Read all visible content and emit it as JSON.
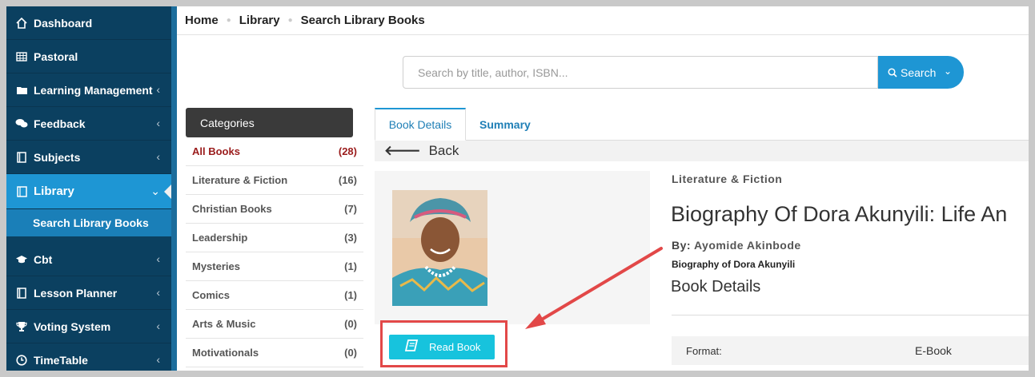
{
  "sidebar": {
    "items": [
      {
        "label": "Dashboard",
        "icon": "home-icon"
      },
      {
        "label": "Pastoral",
        "icon": "table-icon"
      },
      {
        "label": "Learning Management",
        "icon": "folder-icon"
      },
      {
        "label": "Feedback",
        "icon": "chat-icon"
      },
      {
        "label": "Subjects",
        "icon": "book-icon"
      },
      {
        "label": "Library",
        "icon": "book-open-icon"
      },
      {
        "label": "Cbt",
        "icon": "graduation-cap-icon"
      },
      {
        "label": "Lesson Planner",
        "icon": "book-icon"
      },
      {
        "label": "Voting System",
        "icon": "trophy-icon"
      },
      {
        "label": "TimeTable",
        "icon": "clock-icon"
      }
    ],
    "sub_item": "Search Library Books"
  },
  "breadcrumb": [
    "Home",
    "Library",
    "Search Library Books"
  ],
  "search": {
    "placeholder": "Search by title, author, ISBN...",
    "button_label": "Search"
  },
  "categories": {
    "heading": "Categories",
    "items": [
      {
        "name": "All Books",
        "count": "(28)"
      },
      {
        "name": "Literature & Fiction",
        "count": "(16)"
      },
      {
        "name": "Christian Books",
        "count": "(7)"
      },
      {
        "name": "Leadership",
        "count": "(3)"
      },
      {
        "name": "Mysteries",
        "count": "(1)"
      },
      {
        "name": "Comics",
        "count": "(1)"
      },
      {
        "name": "Arts & Music",
        "count": "(0)"
      },
      {
        "name": "Motivationals",
        "count": "(0)"
      }
    ]
  },
  "tabs": [
    "Book Details",
    "Summary"
  ],
  "back_label": "Back",
  "book": {
    "genre": "Literature & Fiction",
    "title": "Biography Of Dora Akunyili: Life An",
    "by_label": "By:",
    "author": "Ayomide Akinbode",
    "description": "Biography of Dora Akunyili",
    "details_heading": "Book Details",
    "format_label": "Format:",
    "format_value": "E-Book",
    "read_button": "Read Book"
  },
  "colors": {
    "sidebar": "#0b4060",
    "accent": "#1e96d4",
    "read_button": "#17c3dd",
    "annotation": "#e24848"
  }
}
